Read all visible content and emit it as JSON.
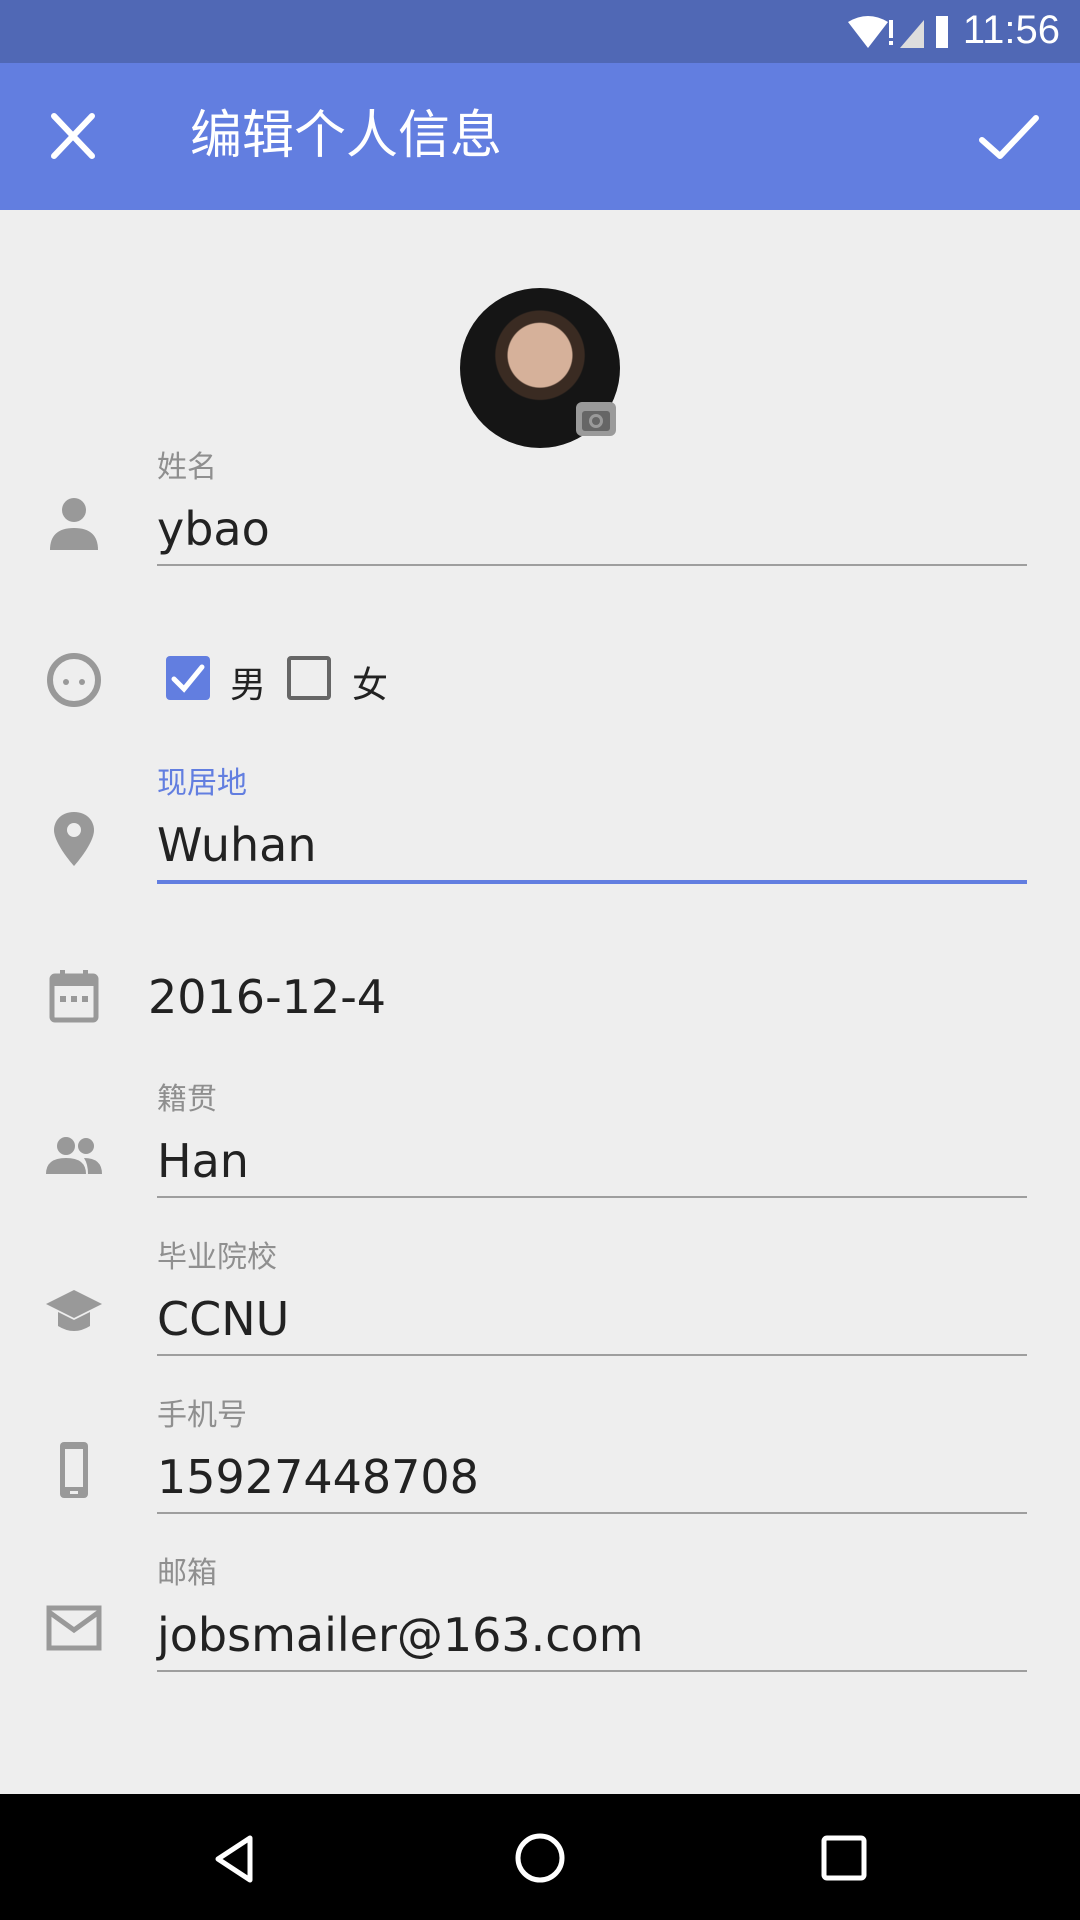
{
  "status": {
    "time": "11:56"
  },
  "toolbar": {
    "title": "编辑个人信息",
    "close_icon": "close-icon",
    "confirm_icon": "check-icon"
  },
  "form": {
    "name": {
      "label": "姓名",
      "value": "ybao"
    },
    "gender": {
      "male": "男",
      "female": "女",
      "male_checked": true,
      "female_checked": false
    },
    "residence": {
      "label": "现居地",
      "value": "Wuhan"
    },
    "birthday": {
      "value": "2016-12-4"
    },
    "ethnicity": {
      "label": "籍贯",
      "value": "Han"
    },
    "school": {
      "label": "毕业院校",
      "value": "CCNU"
    },
    "phone": {
      "label": "手机号",
      "value": "15927448708"
    },
    "email": {
      "label": "邮箱",
      "value": "jobsmailer@163.com"
    }
  },
  "colors": {
    "statusbar": "#5068b5",
    "toolbar": "#627ee0",
    "accent": "#627ee0"
  }
}
